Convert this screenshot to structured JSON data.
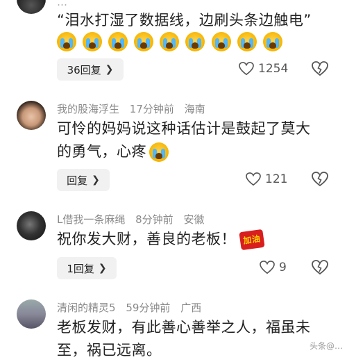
{
  "comments": [
    {
      "meta_partial": "…",
      "text": "“泪水打湿了数据线，边刷头条边触电”",
      "emoji_count": 9,
      "reply_label": "36回复",
      "likes": "1254"
    },
    {
      "username": "我的股海浮生",
      "time": "17分钟前",
      "location": "海南",
      "text": "可怜的妈妈说这种话估计是鼓起了莫大的勇气，心疼",
      "reply_label": "回复",
      "likes": "121"
    },
    {
      "username": "L借我一条麻绳",
      "time": "8分钟前",
      "location": "安徽",
      "text": "祝你发大财，善良的老板！",
      "sticker": "加油",
      "reply_label": "1回复",
      "likes": "9"
    },
    {
      "username": "清闲的精灵5",
      "time": "59分钟前",
      "location": "广西",
      "text": "老板发财，有此善心善举之人，福虽未至，祸已远离。"
    }
  ],
  "watermark": "头条@…",
  "colors": {
    "meta": "#8a8a8a",
    "reply_bg": "#f1f1f1",
    "emoji_tear": "#4fb6ff"
  }
}
